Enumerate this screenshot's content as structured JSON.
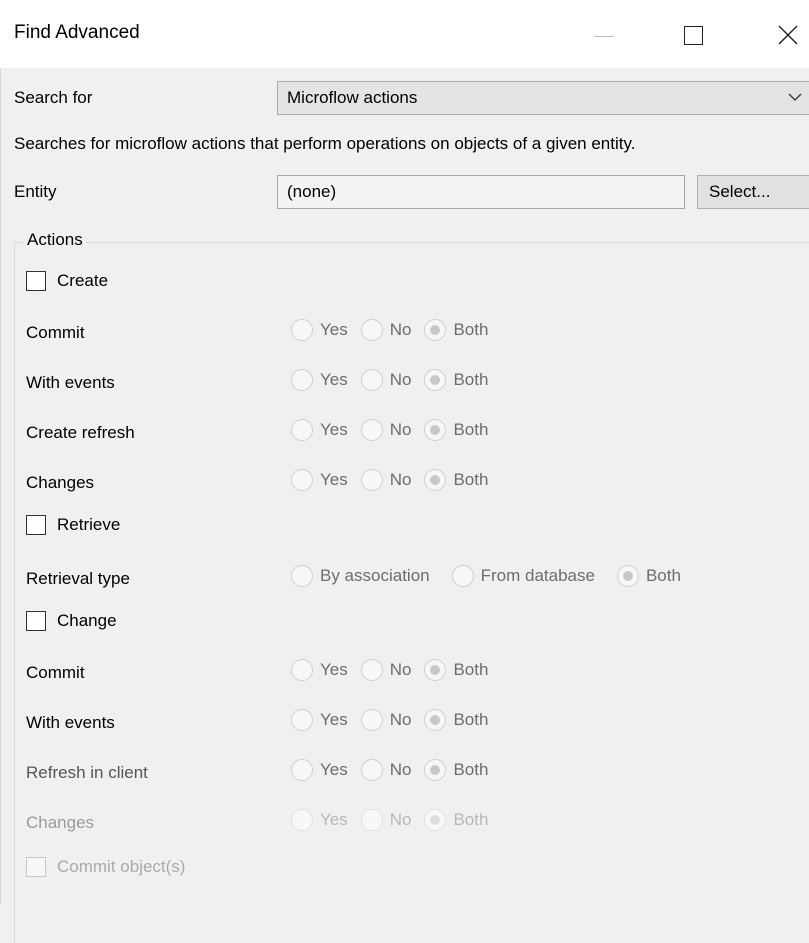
{
  "window": {
    "title": "Find Advanced"
  },
  "search": {
    "label": "Search for",
    "value": "Microflow actions"
  },
  "description": "Searches for microflow actions that perform operations on objects of a given entity.",
  "entity": {
    "label": "Entity",
    "value": "(none)",
    "select_label": "Select..."
  },
  "actions_group": {
    "legend": "Actions"
  },
  "create": {
    "label": "Create",
    "rows": [
      {
        "label": "Commit",
        "options": [
          "Yes",
          "No",
          "Both"
        ],
        "selected": "Both"
      },
      {
        "label": "With events",
        "options": [
          "Yes",
          "No",
          "Both"
        ],
        "selected": "Both"
      },
      {
        "label": "Create refresh",
        "options": [
          "Yes",
          "No",
          "Both"
        ],
        "selected": "Both"
      },
      {
        "label": "Changes",
        "options": [
          "Yes",
          "No",
          "Both"
        ],
        "selected": "Both"
      }
    ]
  },
  "retrieve": {
    "label": "Retrieve",
    "rows": [
      {
        "label": "Retrieval type",
        "options": [
          "By association",
          "From database",
          "Both"
        ],
        "selected": "Both"
      }
    ]
  },
  "change": {
    "label": "Change",
    "rows": [
      {
        "label": "Commit",
        "options": [
          "Yes",
          "No",
          "Both"
        ],
        "selected": "Both"
      },
      {
        "label": "With events",
        "options": [
          "Yes",
          "No",
          "Both"
        ],
        "selected": "Both"
      },
      {
        "label": "Refresh in client",
        "options": [
          "Yes",
          "No",
          "Both"
        ],
        "selected": "Both"
      },
      {
        "label": "Changes",
        "options": [
          "Yes",
          "No",
          "Both"
        ],
        "selected": "Both"
      }
    ]
  },
  "commit_objects": {
    "label": "Commit object(s)"
  },
  "icons": {
    "minimize": "minimize-icon",
    "maximize": "maximize-icon",
    "close": "close-icon",
    "dropdown": "chevron-down-icon"
  }
}
